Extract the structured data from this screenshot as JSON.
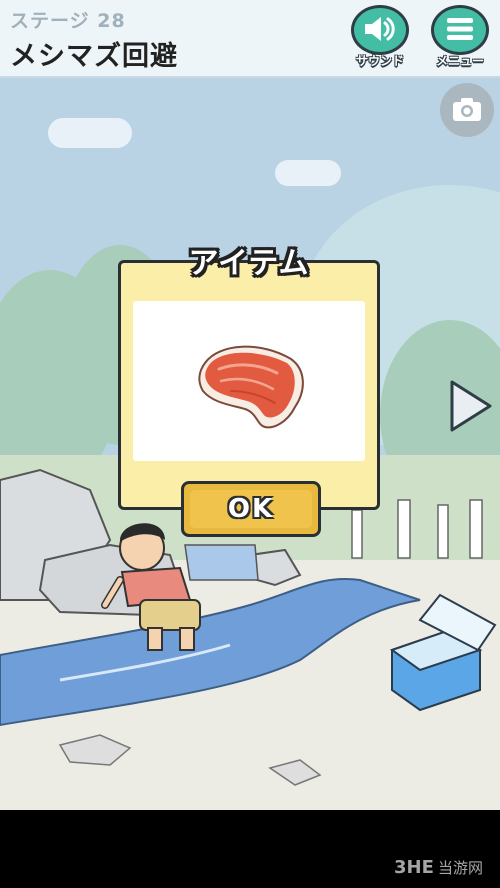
{
  "header": {
    "stage_label": "ステージ 28",
    "level_title": "メシマズ回避",
    "sound_label": "サウンド",
    "menu_label": "メニュー"
  },
  "dialog": {
    "title": "アイテム",
    "item": "meat-steak",
    "ok_label": "OK"
  },
  "icons": {
    "sound": "speaker-icon",
    "menu": "hamburger-icon",
    "camera": "camera-icon",
    "next": "arrow-right-icon"
  },
  "colors": {
    "sky": "#b9d3e4",
    "header_bg": "#eef5f9",
    "button_teal": "#43bda4",
    "dialog_bg": "#fbeea9",
    "ok_yellow": "#efc34c",
    "river": "#6f9ed8"
  }
}
